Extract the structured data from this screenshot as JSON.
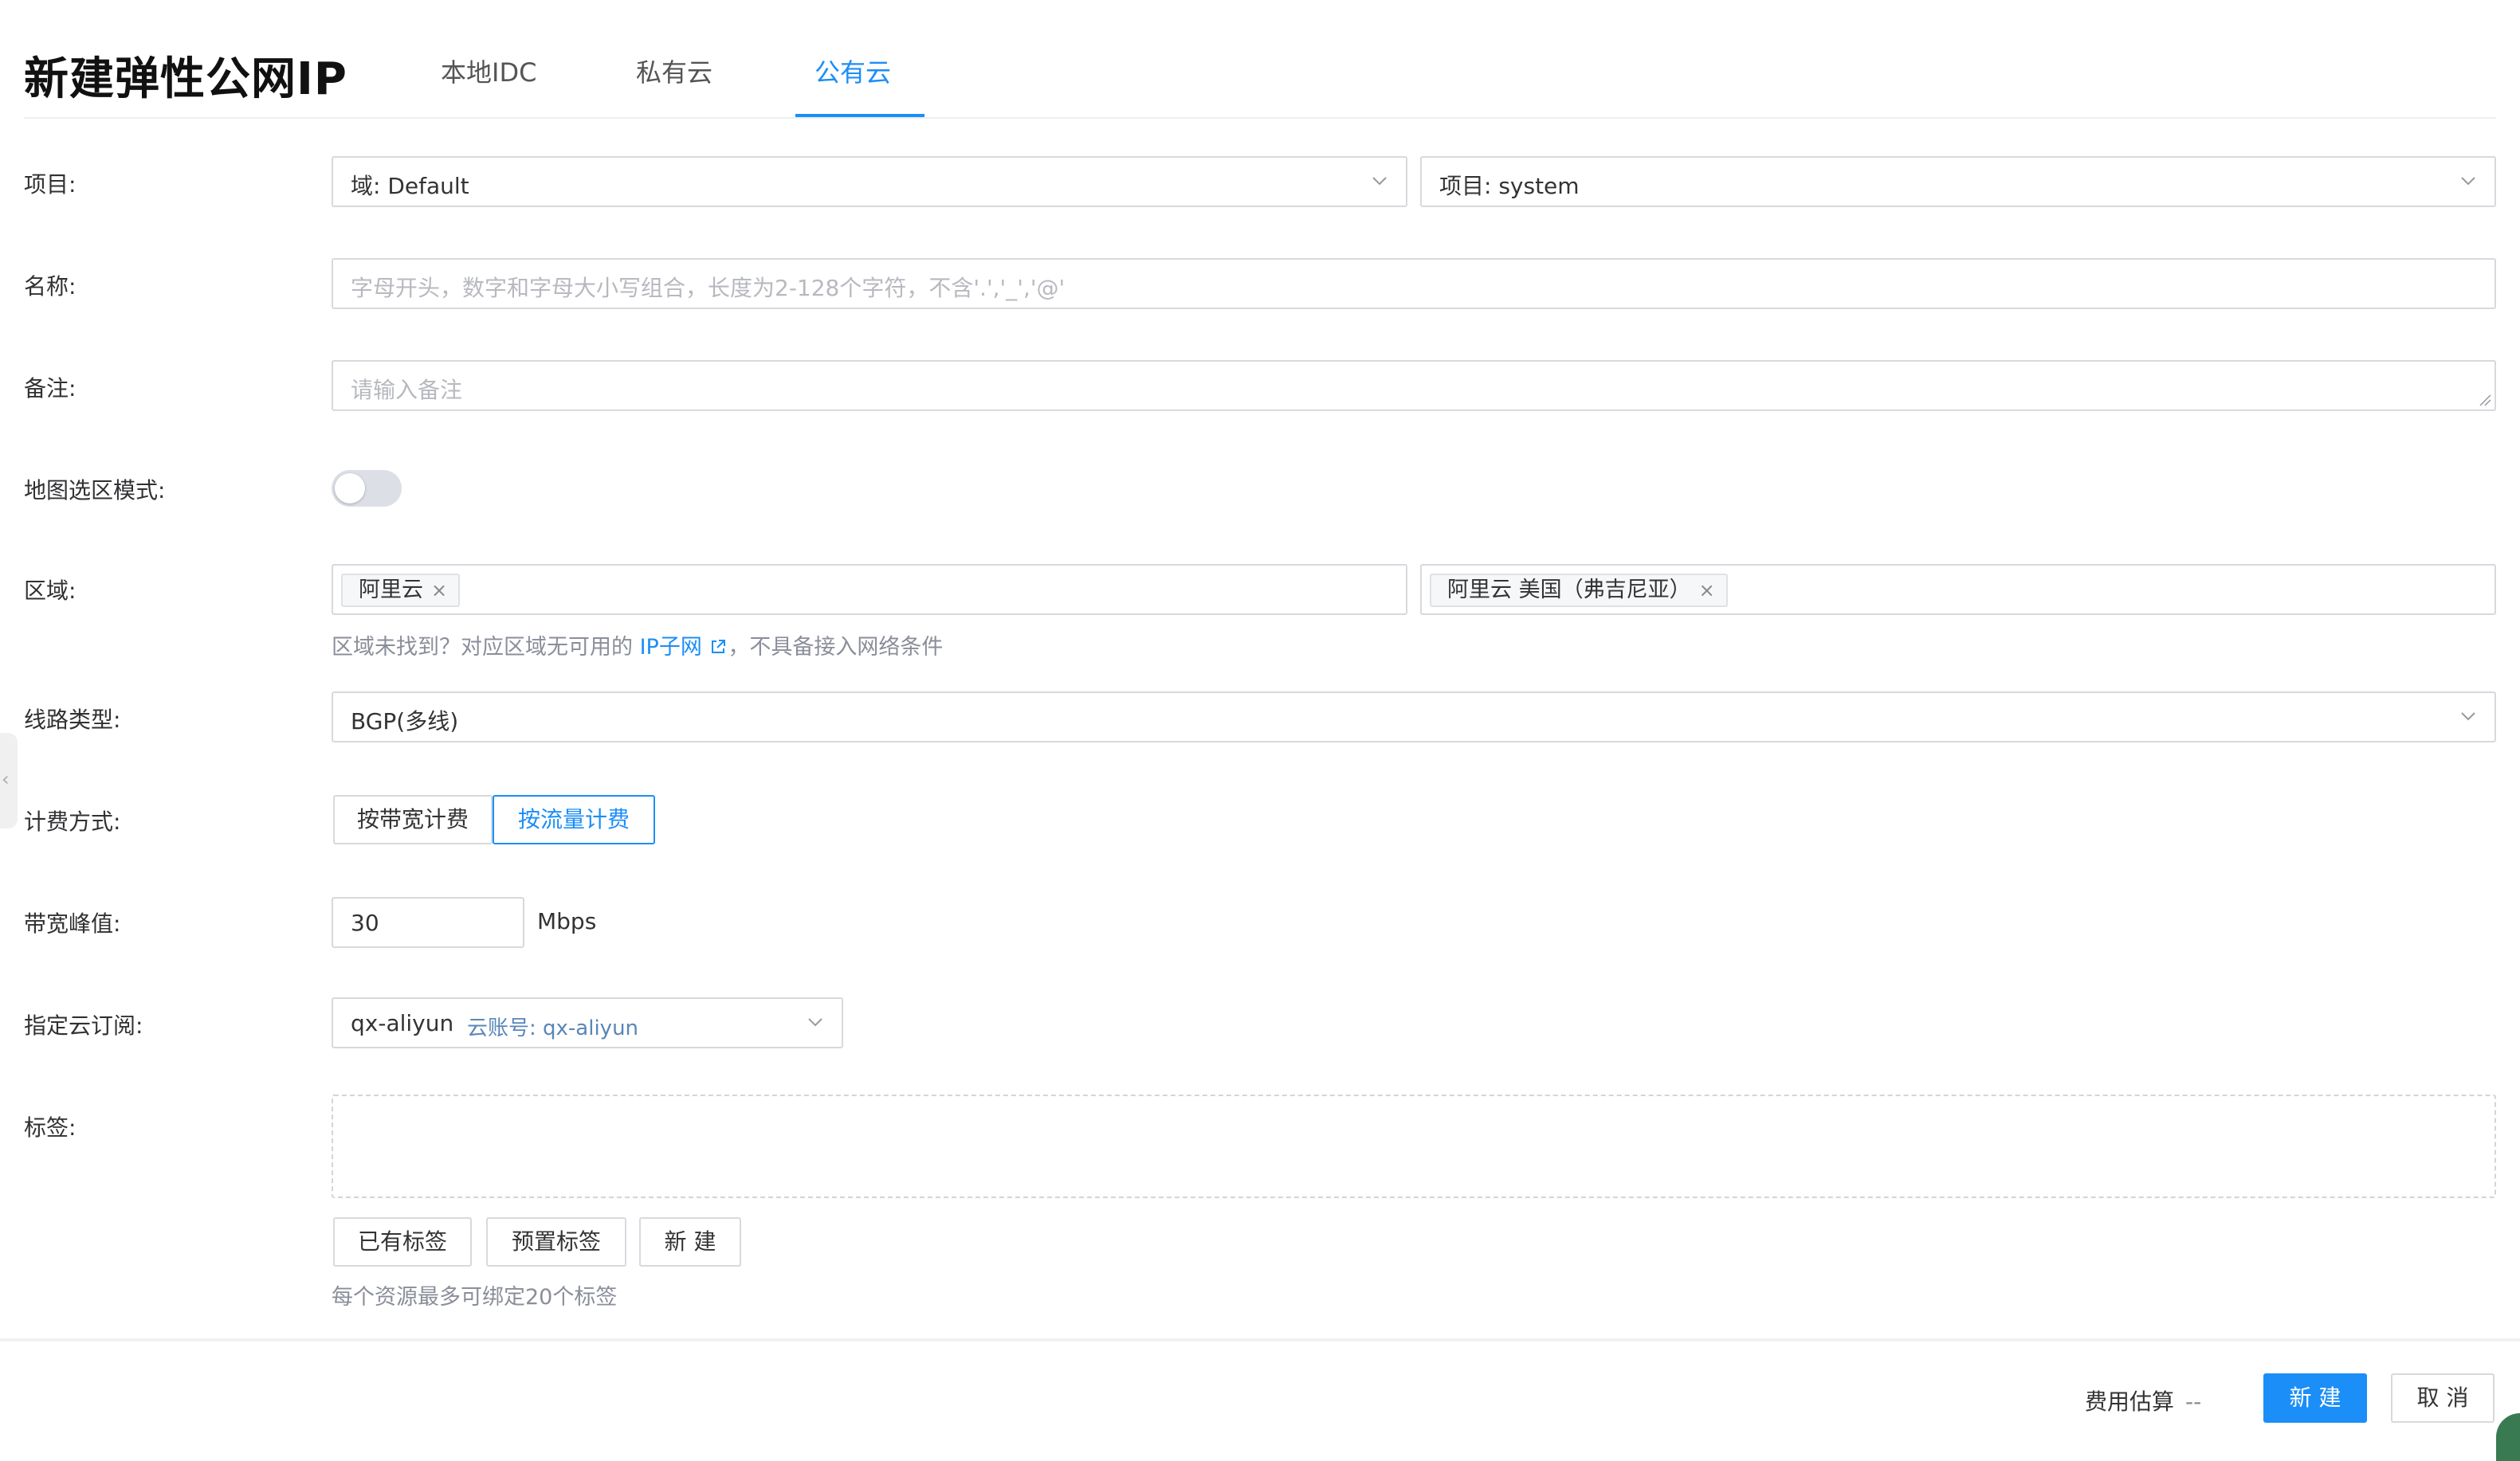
{
  "header": {
    "title": "新建弹性公网IP",
    "tabs": [
      {
        "label": "本地IDC"
      },
      {
        "label": "私有云"
      },
      {
        "label": "公有云"
      }
    ],
    "active_tab": 2
  },
  "form": {
    "project": {
      "label": "项目:",
      "domain_value": "域: Default",
      "project_value": "项目: system"
    },
    "name": {
      "label": "名称:",
      "placeholder": "字母开头，数字和字母大小写组合，长度为2-128个字符，不含'.','_','@'"
    },
    "remark": {
      "label": "备注:",
      "placeholder": "请输入备注"
    },
    "map_mode": {
      "label": "地图选区模式:",
      "enabled": false
    },
    "region": {
      "label": "区域:",
      "provider_tag": "阿里云",
      "region_tag": "阿里云 美国（弗吉尼亚）",
      "help_prefix": "区域未找到？对应区域无可用的",
      "help_link": "IP子网",
      "help_suffix": "，不具备接入网络条件"
    },
    "line_type": {
      "label": "线路类型:",
      "value": "BGP(多线)"
    },
    "billing": {
      "label": "计费方式:",
      "options": [
        "按带宽计费",
        "按流量计费"
      ],
      "selected": 1
    },
    "bandwidth": {
      "label": "带宽峰值:",
      "value": "30",
      "unit": "Mbps"
    },
    "subscription": {
      "label": "指定云订阅:",
      "value": "qx-aliyun",
      "account": "云账号: qx-aliyun"
    },
    "tags": {
      "label": "标签:",
      "buttons": [
        "已有标签",
        "预置标签",
        "新 建"
      ],
      "help": "每个资源最多可绑定20个标签"
    }
  },
  "footer": {
    "fee_label": "费用估算",
    "fee_value": "--",
    "create_label": "新 建",
    "cancel_label": "取 消"
  },
  "colors": {
    "accent": "#1b8ef7",
    "border": "#d7d9de",
    "placeholder": "#b7b9bf"
  },
  "icons": [
    "chevron-down-icon",
    "close-icon",
    "external-link-icon",
    "collapse-left-icon"
  ]
}
